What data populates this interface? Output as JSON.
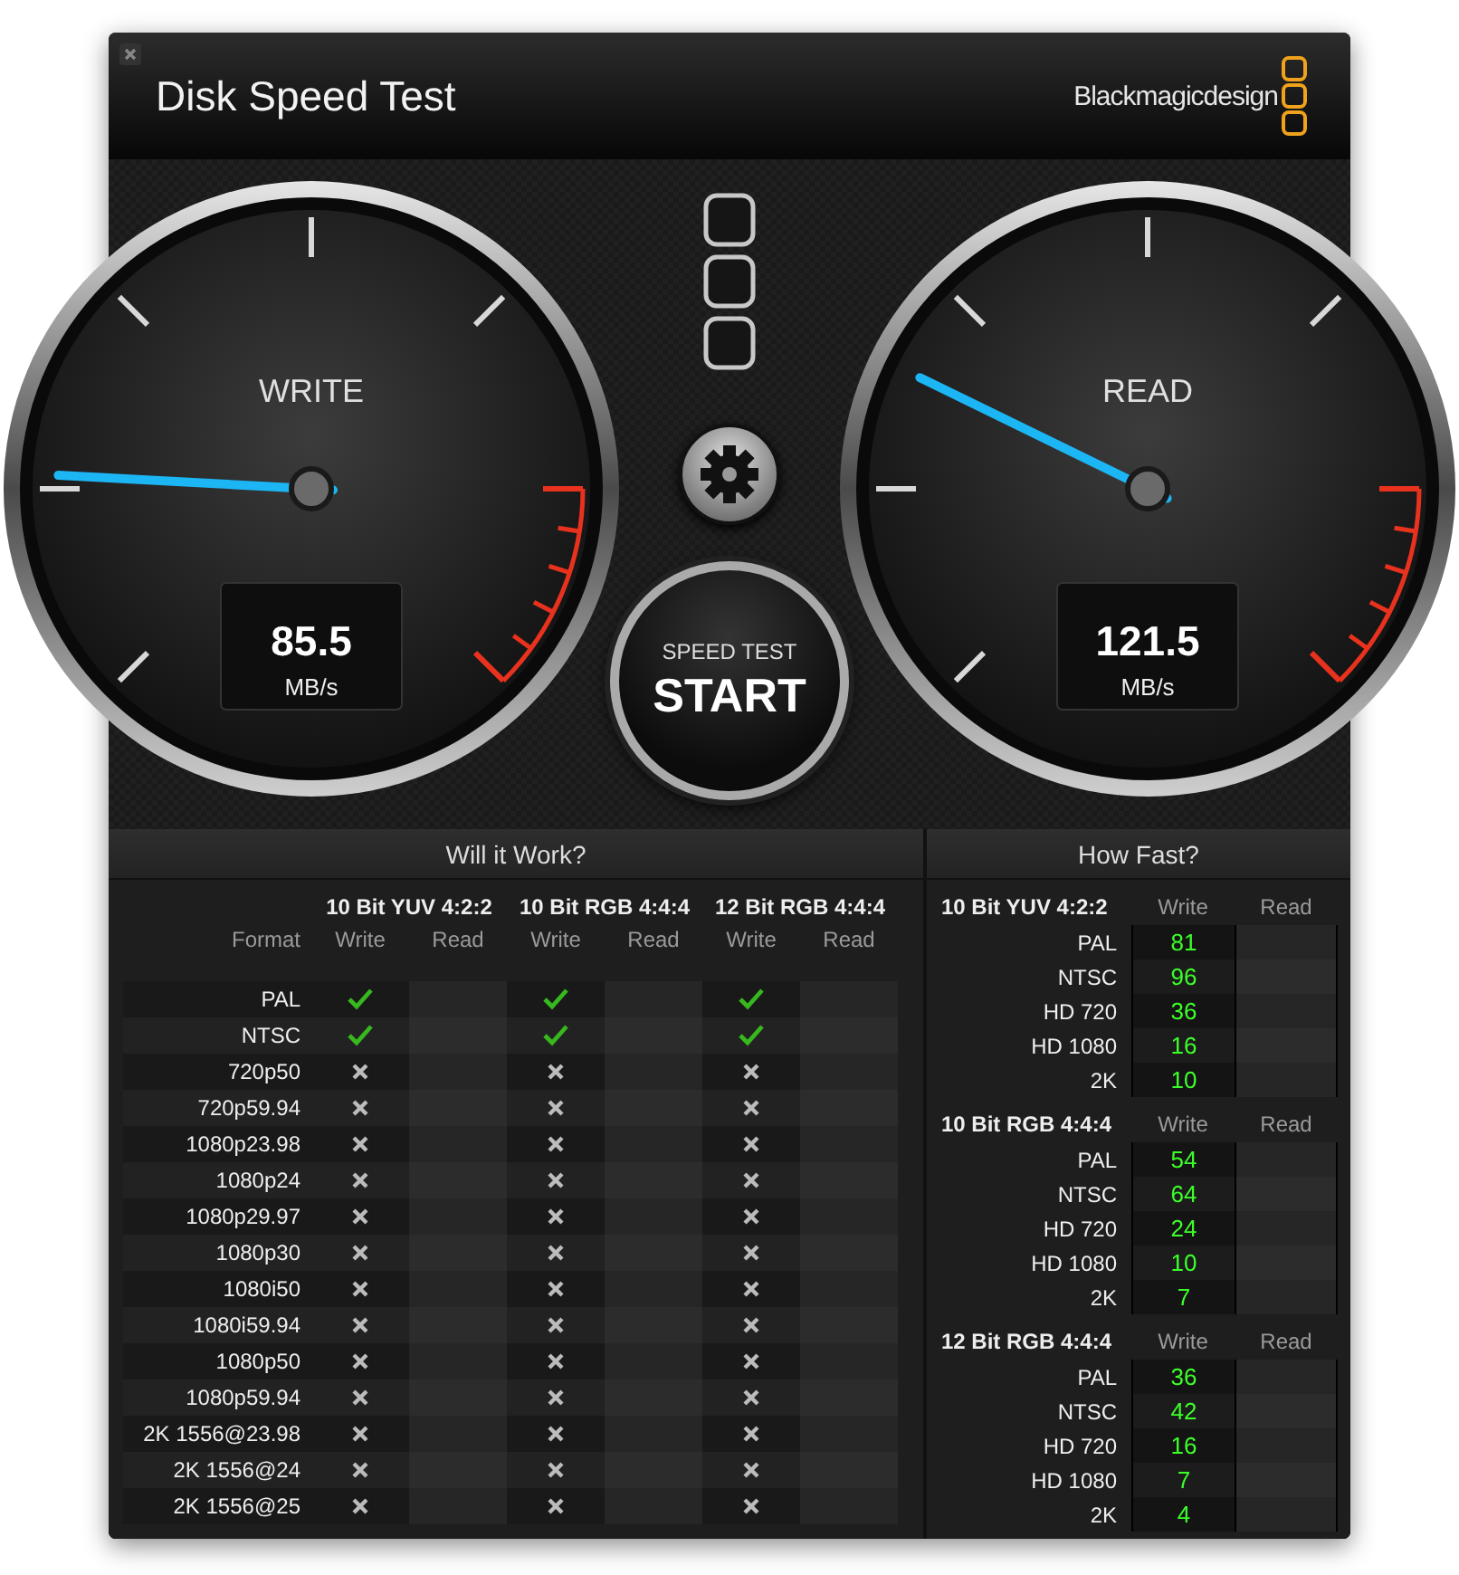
{
  "window": {
    "title": "Disk Speed Test",
    "brand": "Blackmagicdesign"
  },
  "gauges": [
    {
      "label": "WRITE",
      "value": "85.5",
      "unit": "MB/s",
      "level": 0.178
    },
    {
      "label": "READ",
      "value": "121.5",
      "unit": "MB/s",
      "level": 0.263
    }
  ],
  "start_button": {
    "caption": "SPEED TEST",
    "label": "START"
  },
  "will_it_work": {
    "title": "Will it Work?",
    "format_heading": "Format",
    "groups": [
      {
        "name": "10 Bit YUV 4:2:2",
        "columns": [
          "Write",
          "Read"
        ]
      },
      {
        "name": "10 Bit RGB 4:4:4",
        "columns": [
          "Write",
          "Read"
        ]
      },
      {
        "name": "12 Bit RGB 4:4:4",
        "columns": [
          "Write",
          "Read"
        ]
      }
    ],
    "rows": [
      {
        "format": "PAL",
        "write_ok": [
          true,
          true,
          true
        ]
      },
      {
        "format": "NTSC",
        "write_ok": [
          true,
          true,
          true
        ]
      },
      {
        "format": "720p50",
        "write_ok": [
          false,
          false,
          false
        ]
      },
      {
        "format": "720p59.94",
        "write_ok": [
          false,
          false,
          false
        ]
      },
      {
        "format": "1080p23.98",
        "write_ok": [
          false,
          false,
          false
        ]
      },
      {
        "format": "1080p24",
        "write_ok": [
          false,
          false,
          false
        ]
      },
      {
        "format": "1080p29.97",
        "write_ok": [
          false,
          false,
          false
        ]
      },
      {
        "format": "1080p30",
        "write_ok": [
          false,
          false,
          false
        ]
      },
      {
        "format": "1080i50",
        "write_ok": [
          false,
          false,
          false
        ]
      },
      {
        "format": "1080i59.94",
        "write_ok": [
          false,
          false,
          false
        ]
      },
      {
        "format": "1080p50",
        "write_ok": [
          false,
          false,
          false
        ]
      },
      {
        "format": "1080p59.94",
        "write_ok": [
          false,
          false,
          false
        ]
      },
      {
        "format": "2K 1556@23.98",
        "write_ok": [
          false,
          false,
          false
        ]
      },
      {
        "format": "2K 1556@24",
        "write_ok": [
          false,
          false,
          false
        ]
      },
      {
        "format": "2K 1556@25",
        "write_ok": [
          false,
          false,
          false
        ]
      }
    ]
  },
  "how_fast": {
    "title": "How Fast?",
    "groups": [
      {
        "name": "10 Bit YUV 4:2:2",
        "columns": [
          "Write",
          "Read"
        ],
        "rows": [
          {
            "format": "PAL",
            "write": "81"
          },
          {
            "format": "NTSC",
            "write": "96"
          },
          {
            "format": "HD 720",
            "write": "36"
          },
          {
            "format": "HD 1080",
            "write": "16"
          },
          {
            "format": "2K",
            "write": "10"
          }
        ]
      },
      {
        "name": "10 Bit RGB 4:4:4",
        "columns": [
          "Write",
          "Read"
        ],
        "rows": [
          {
            "format": "PAL",
            "write": "54"
          },
          {
            "format": "NTSC",
            "write": "64"
          },
          {
            "format": "HD 720",
            "write": "24"
          },
          {
            "format": "HD 1080",
            "write": "10"
          },
          {
            "format": "2K",
            "write": "7"
          }
        ]
      },
      {
        "name": "12 Bit RGB 4:4:4",
        "columns": [
          "Write",
          "Read"
        ],
        "rows": [
          {
            "format": "PAL",
            "write": "36"
          },
          {
            "format": "NTSC",
            "write": "42"
          },
          {
            "format": "HD 720",
            "write": "16"
          },
          {
            "format": "HD 1080",
            "write": "7"
          },
          {
            "format": "2K",
            "write": "4"
          }
        ]
      }
    ]
  }
}
